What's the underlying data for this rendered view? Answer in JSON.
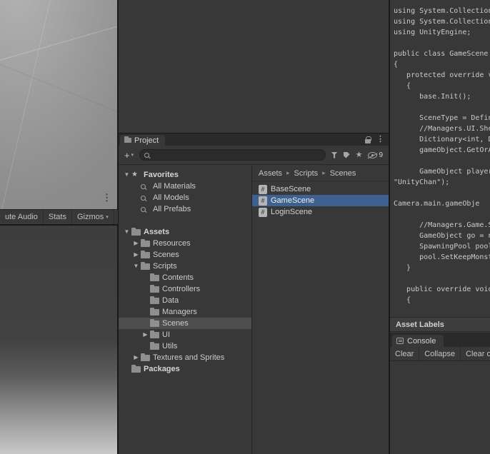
{
  "icons": {
    "tri_open": "▼",
    "tri_closed": "▶",
    "star": "★",
    "kebab": "⋮",
    "crumb_sep": "▸",
    "plus": "+",
    "dropdown": "▾",
    "hash": "#"
  },
  "game_view": {
    "toolbar": {
      "mute_audio": "ute Audio",
      "stats": "Stats",
      "gizmos": "Gizmos"
    }
  },
  "project": {
    "tab": "Project",
    "search_value": "",
    "visibility_count": "9",
    "tree": {
      "items": [
        {
          "label": "Favorites"
        },
        {
          "label": "All Materials"
        },
        {
          "label": "All Models"
        },
        {
          "label": "All Prefabs"
        },
        {
          "label": "Assets"
        },
        {
          "label": "Resources"
        },
        {
          "label": "Scenes"
        },
        {
          "label": "Scripts"
        },
        {
          "label": "Contents"
        },
        {
          "label": "Controllers"
        },
        {
          "label": "Data"
        },
        {
          "label": "Managers"
        },
        {
          "label": "Scenes"
        },
        {
          "label": "UI"
        },
        {
          "label": "Utils"
        },
        {
          "label": "Textures and Sprites"
        },
        {
          "label": "Packages"
        }
      ]
    },
    "breadcrumb": [
      "Assets",
      "Scripts",
      "Scenes"
    ],
    "files": [
      {
        "label": "BaseScene"
      },
      {
        "label": "GameScene"
      },
      {
        "label": "LoginScene"
      }
    ]
  },
  "inspector": {
    "asset_labels": "Asset Labels",
    "code_lines": [
      "using System.Collections",
      "using System.Collections",
      "using UnityEngine;",
      "",
      "public class GameScene",
      "{",
      "   protected override voi",
      "   {",
      "      base.Init();",
      "",
      "      SceneType = Define",
      "      //Managers.UI.Show",
      "      Dictionary<int, Data",
      "      gameObject.GetOrA",
      "",
      "      GameObject player",
      "\"UnityChan\");",
      "",
      "Camera.main.gameObje",
      "",
      "      //Managers.Game.Sp",
      "      GameObject go = ne",
      "      SpawningPool pool",
      "      pool.SetKeepMonste",
      "   }",
      "",
      "   public override void Cl",
      "   {"
    ]
  },
  "console": {
    "tab": "Console",
    "buttons": {
      "clear": "Clear",
      "collapse": "Collapse",
      "clear_on_play": "Clear o"
    }
  }
}
